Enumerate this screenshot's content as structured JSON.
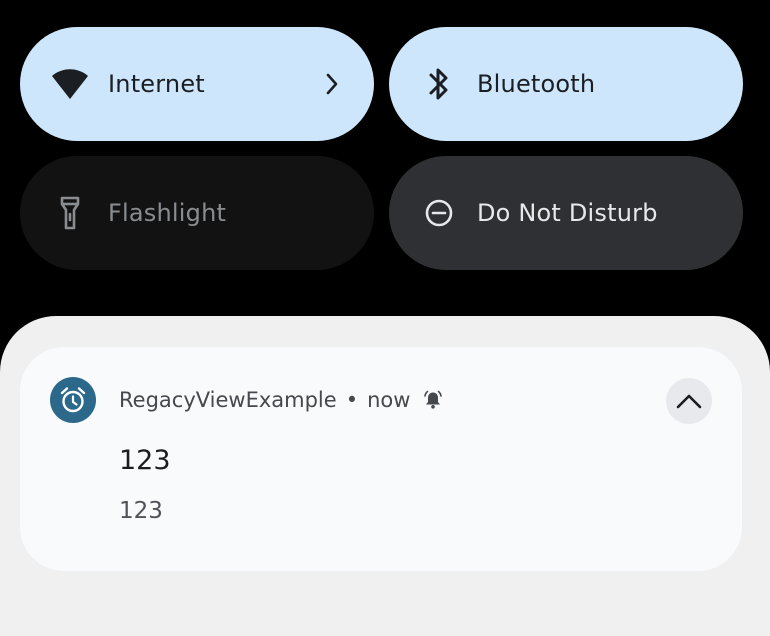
{
  "quick_settings": {
    "tiles": [
      {
        "label": "Internet",
        "icon": "wifi-icon",
        "state": "on",
        "has_chevron": true
      },
      {
        "label": "Bluetooth",
        "icon": "bluetooth-icon",
        "state": "on"
      },
      {
        "label": "Flashlight",
        "icon": "flashlight-icon",
        "state": "unavailable"
      },
      {
        "label": "Do Not Disturb",
        "icon": "do-not-disturb-icon",
        "state": "off"
      }
    ]
  },
  "notification": {
    "app_name": "RegacyViewExample",
    "separator": "•",
    "time": "now",
    "title": "123",
    "text": "123",
    "app_icon": "alarm-clock-icon",
    "alert_icon": "bell-icon",
    "expand_icon": "chevron-up-icon"
  },
  "colors": {
    "background": "#000000",
    "tile_on": "#cde6fb",
    "tile_off": "#2f3033",
    "tile_unavailable": "#121212",
    "shade": "#f0f0f0",
    "card": "#f8fafc",
    "app_icon_bg": "#2c6889"
  }
}
